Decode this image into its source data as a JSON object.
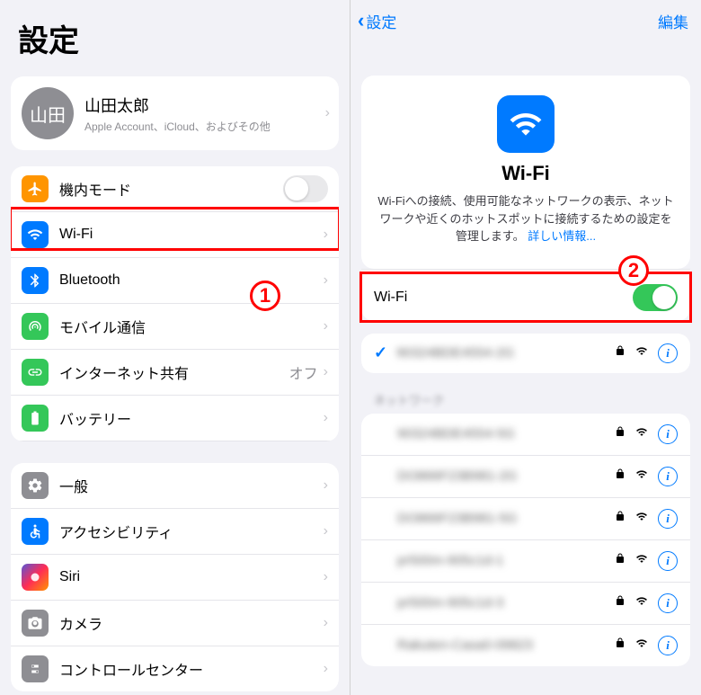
{
  "left": {
    "title": "設定",
    "account": {
      "avatar_text": "山田",
      "name": "山田太郎",
      "sub": "Apple Account、iCloud、およびその他"
    },
    "group1": [
      {
        "id": "airplane",
        "label": "機内モード",
        "icon": "airplane",
        "detail": "",
        "toggle": "off"
      },
      {
        "id": "wifi",
        "label": "Wi-Fi",
        "icon": "wifi",
        "detail": "",
        "chevron": true
      },
      {
        "id": "bluetooth",
        "label": "Bluetooth",
        "icon": "bluetooth",
        "detail": "",
        "chevron": true
      },
      {
        "id": "cellular",
        "label": "モバイル通信",
        "icon": "antenna",
        "detail": "",
        "chevron": true
      },
      {
        "id": "hotspot",
        "label": "インターネット共有",
        "icon": "link",
        "detail": "オフ",
        "chevron": true
      },
      {
        "id": "battery",
        "label": "バッテリー",
        "icon": "battery",
        "detail": "",
        "chevron": true
      }
    ],
    "group2": [
      {
        "id": "general",
        "label": "一般",
        "icon": "gear",
        "chevron": true
      },
      {
        "id": "accessibility",
        "label": "アクセシビリティ",
        "icon": "accessibility",
        "chevron": true
      },
      {
        "id": "siri",
        "label": "Siri",
        "icon": "siri",
        "chevron": true
      },
      {
        "id": "camera",
        "label": "カメラ",
        "icon": "camera",
        "chevron": true
      },
      {
        "id": "controlcenter",
        "label": "コントロールセンター",
        "icon": "switches",
        "chevron": true
      }
    ],
    "annotation_1": "1"
  },
  "right": {
    "nav_back": "設定",
    "nav_edit": "編集",
    "hero_title": "Wi-Fi",
    "hero_desc": "Wi-Fiへの接続、使用可能なネットワークの表示、ネットワークや近くのホットスポットに接続するための設定を管理します。",
    "hero_link": "詳しい情報...",
    "wifi_toggle_label": "Wi-Fi",
    "current_network": "90324BDE4554-2G",
    "networks_header": "ネットワーク",
    "networks": [
      "90324BDE4554-5G",
      "DO866F23B981-2G",
      "DO866F23B981-5G",
      "pr500m-905c1d-1",
      "pr500m-905c1d-3",
      "Rakuten-Casa0-09823"
    ],
    "annotation_2": "2"
  }
}
